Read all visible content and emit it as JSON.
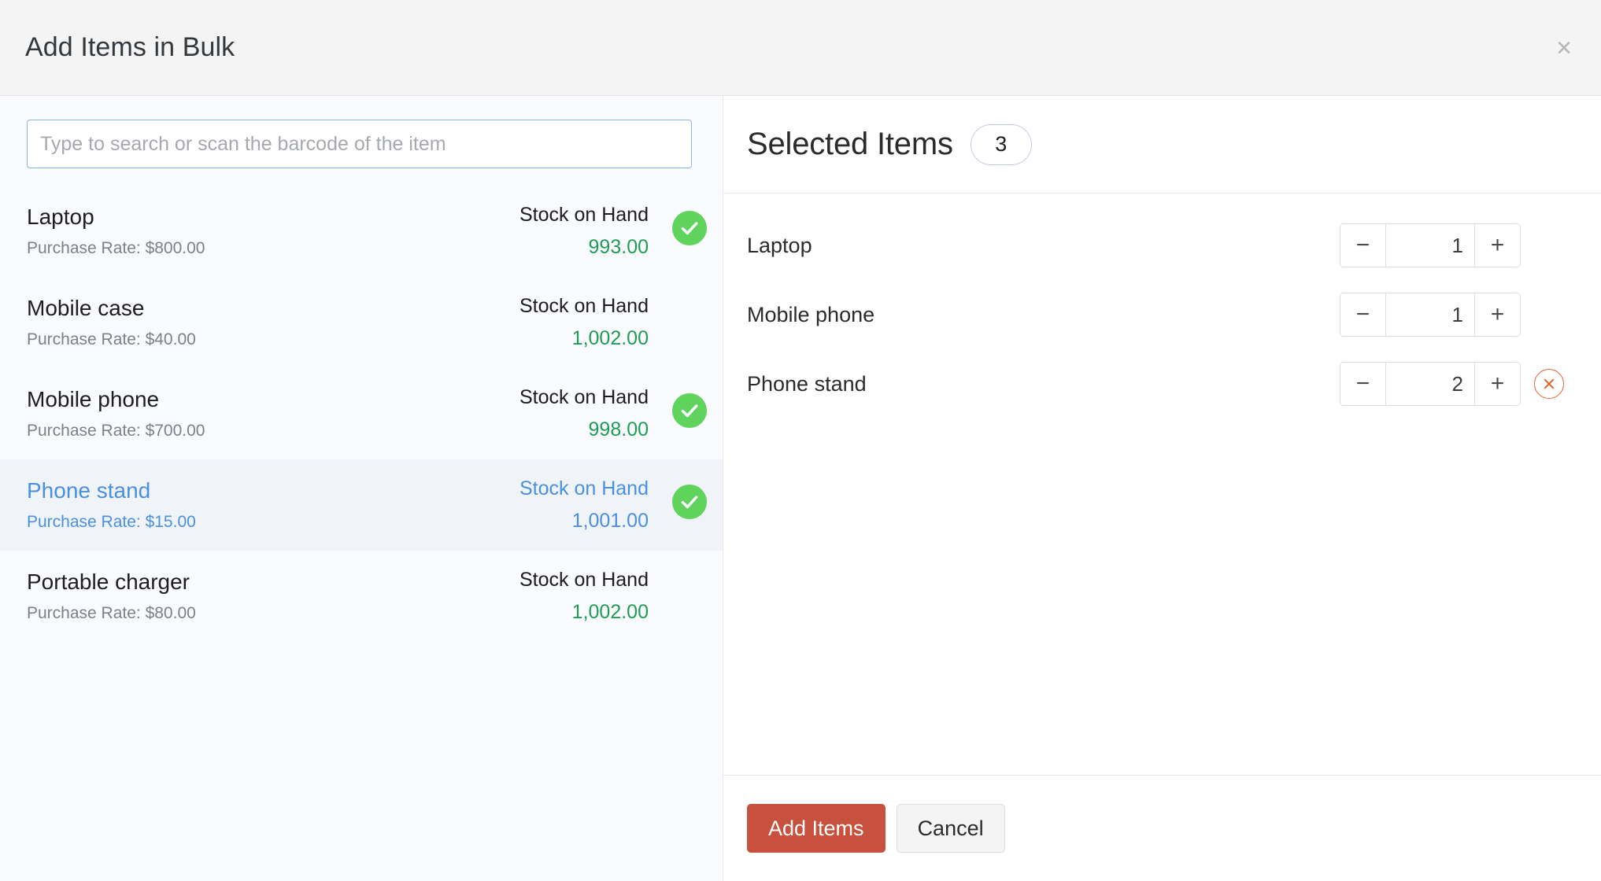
{
  "header": {
    "title": "Add Items in Bulk",
    "close_icon": "close-icon",
    "close_glyph": "×"
  },
  "search": {
    "value": "",
    "placeholder": "Type to search or scan the barcode of the item"
  },
  "item_list": {
    "stock_label": "Stock on Hand",
    "rate_prefix": "Purchase Rate: ",
    "items": [
      {
        "name": "Laptop",
        "rate": "Purchase Rate: $800.00",
        "stock_label": "Stock on Hand",
        "stock": "993.00",
        "selected": true,
        "active": false
      },
      {
        "name": "Mobile case",
        "rate": "Purchase Rate: $40.00",
        "stock_label": "Stock on Hand",
        "stock": "1,002.00",
        "selected": false,
        "active": false
      },
      {
        "name": "Mobile phone",
        "rate": "Purchase Rate: $700.00",
        "stock_label": "Stock on Hand",
        "stock": "998.00",
        "selected": true,
        "active": false
      },
      {
        "name": "Phone stand",
        "rate": "Purchase Rate: $15.00",
        "stock_label": "Stock on Hand",
        "stock": "1,001.00",
        "selected": true,
        "active": true
      },
      {
        "name": "Portable charger",
        "rate": "Purchase Rate: $80.00",
        "stock_label": "Stock on Hand",
        "stock": "1,002.00",
        "selected": false,
        "active": false
      }
    ]
  },
  "selected_panel": {
    "title": "Selected Items",
    "count": "3",
    "decrement_glyph": "−",
    "increment_glyph": "+",
    "rows": [
      {
        "name": "Laptop",
        "quantity": "1",
        "show_remove": false
      },
      {
        "name": "Mobile phone",
        "quantity": "1",
        "show_remove": false
      },
      {
        "name": "Phone stand",
        "quantity": "2",
        "show_remove": true
      }
    ]
  },
  "footer": {
    "primary_label": "Add Items",
    "secondary_label": "Cancel"
  },
  "colors": {
    "primary_button": "#c7513c",
    "check_green": "#60d35c",
    "stock_green": "#1f9d55",
    "active_blue": "#4a90e2",
    "remove_orange": "#e2672c",
    "left_pane_bg": "#fafbfe",
    "header_bg": "#f4f4f5"
  }
}
